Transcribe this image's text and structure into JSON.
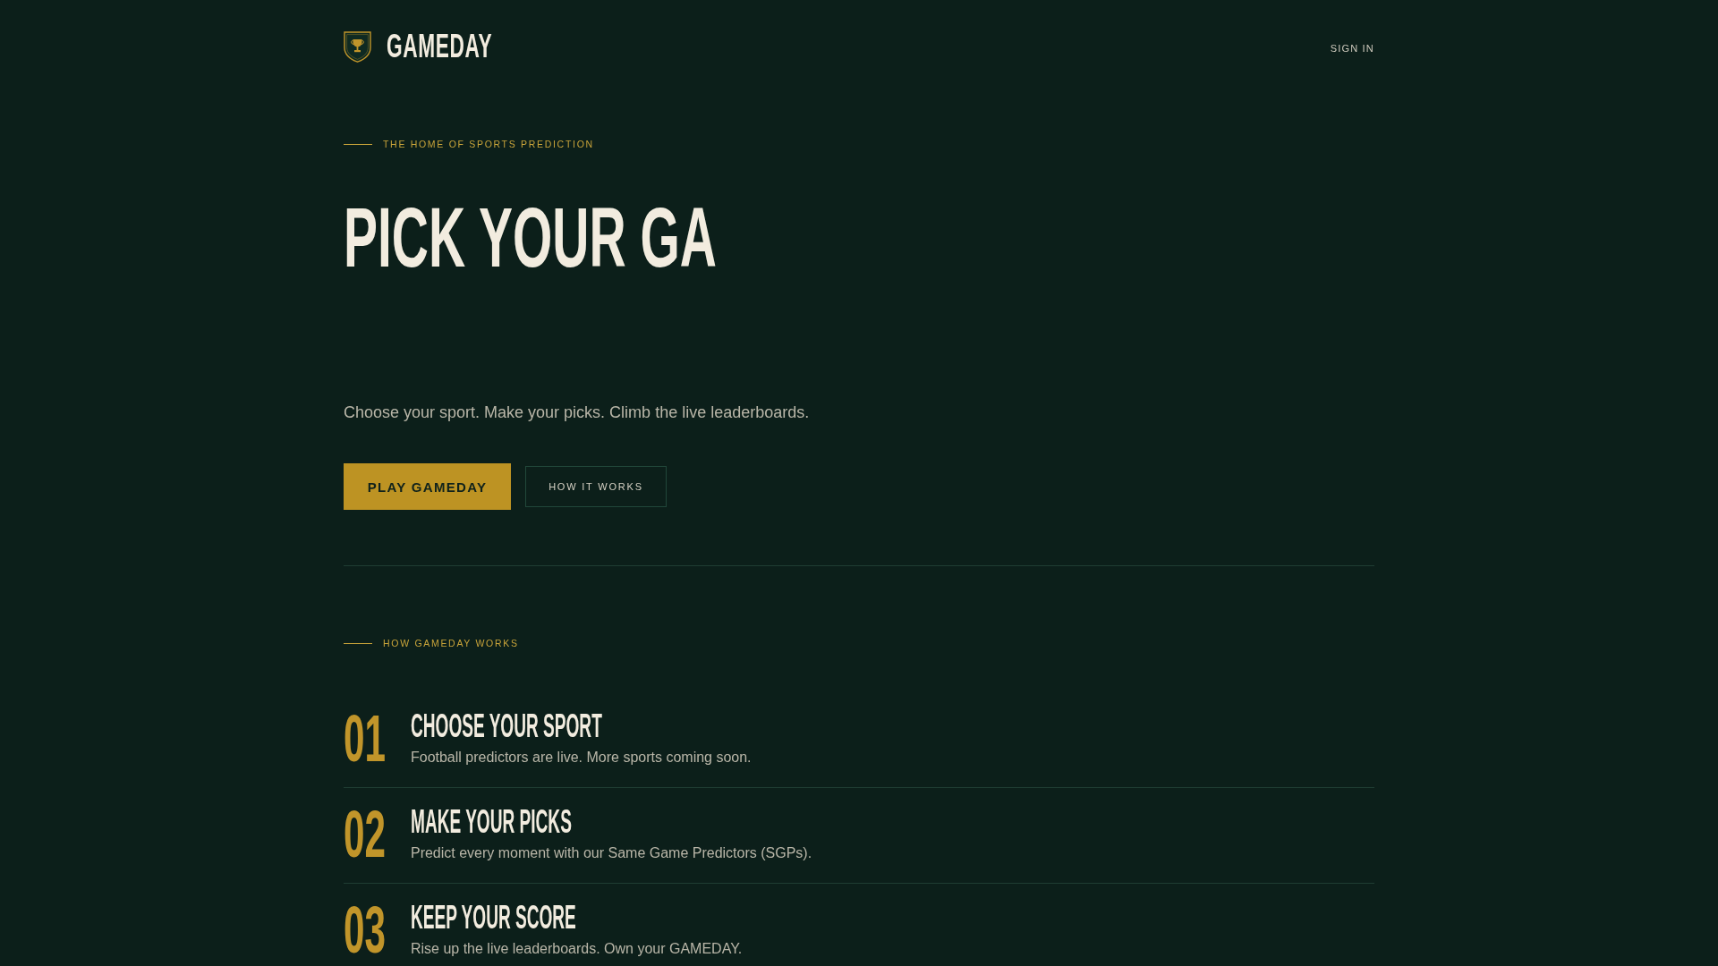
{
  "header": {
    "brand": "GAMEDAY",
    "nav_link": "SIGN IN"
  },
  "hero": {
    "eyebrow": "THE HOME OF SPORTS PREDICTION",
    "headline": "PICK YOUR GA",
    "subtitle": "Choose your sport. Make your picks. Climb the live leaderboards.",
    "buttons": [
      {
        "label": "PLAY GAMEDAY",
        "kind": "primary"
      },
      {
        "label": "HOW IT WORKS",
        "kind": "secondary"
      }
    ]
  },
  "how_it_works": {
    "eyebrow": "HOW GAMEDAY WORKS",
    "steps": [
      {
        "number": "01",
        "title": "CHOOSE YOUR SPORT",
        "description": "Football predictors are live. More sports coming soon."
      },
      {
        "number": "02",
        "title": "MAKE YOUR PICKS",
        "description": "Predict every moment with our Same Game Predictors (SGPs)."
      },
      {
        "number": "03",
        "title": "KEEP YOUR SCORE",
        "description": "Rise up the live leaderboards. Own your GAMEDAY."
      }
    ]
  }
}
